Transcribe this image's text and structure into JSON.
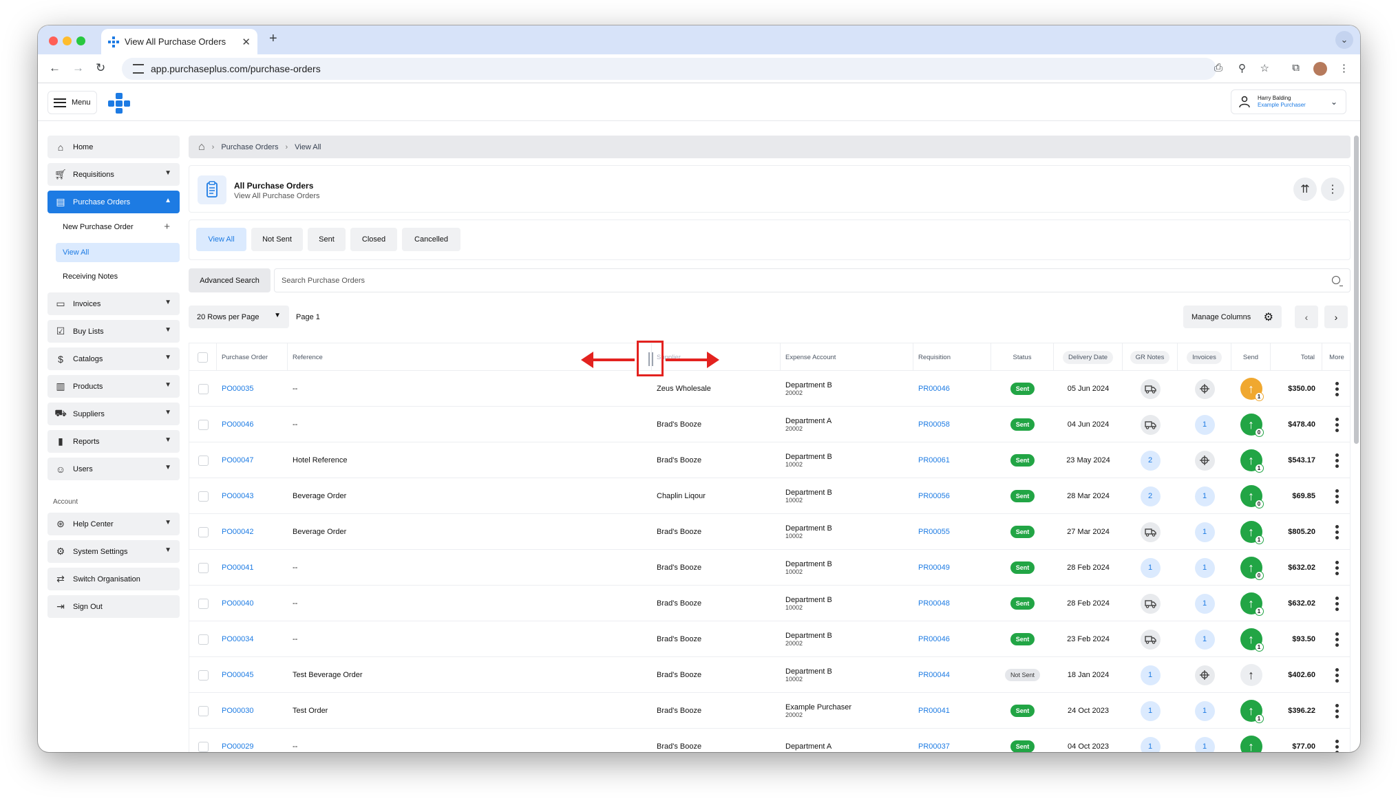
{
  "browser": {
    "tab_title": "View All Purchase Orders",
    "url": "app.purchaseplus.com/purchase-orders",
    "traffic_colors": [
      "#ff5f57",
      "#febc2e",
      "#28c840"
    ]
  },
  "header": {
    "menu_label": "Menu",
    "user_name": "Harry Balding",
    "user_role": "Example Purchaser"
  },
  "sidebar": {
    "home": "Home",
    "requisitions": "Requisitions",
    "purchase_orders": "Purchase Orders",
    "new_po": "New Purchase Order",
    "view_all": "View All",
    "receiving_notes": "Receiving Notes",
    "invoices": "Invoices",
    "buy_lists": "Buy Lists",
    "catalogs": "Catalogs",
    "products": "Products",
    "suppliers": "Suppliers",
    "reports": "Reports",
    "users": "Users",
    "account_label": "Account",
    "help_center": "Help Center",
    "system_settings": "System Settings",
    "switch_org": "Switch Organisation",
    "sign_out": "Sign Out"
  },
  "breadcrumb": {
    "level1": "Purchase Orders",
    "level2": "View All"
  },
  "page": {
    "title": "All Purchase Orders",
    "subtitle": "View All Purchase Orders"
  },
  "filters": [
    "View All",
    "Not Sent",
    "Sent",
    "Closed",
    "Cancelled"
  ],
  "search": {
    "advanced_label": "Advanced Search",
    "placeholder": "Search Purchase Orders"
  },
  "pagination": {
    "rows_label": "20 Rows per Page",
    "page_label": "Page 1",
    "manage_columns": "Manage Columns"
  },
  "table": {
    "headers": {
      "purchase_order": "Purchase Order",
      "reference": "Reference",
      "supplier": "Supplier",
      "expense_account": "Expense Account",
      "requisition": "Requisition",
      "status": "Status",
      "delivery_date": "Delivery Date",
      "gr_notes": "GR Notes",
      "invoices": "Invoices",
      "send": "Send",
      "total": "Total",
      "more": "More"
    },
    "rows": [
      {
        "po": "PO00035",
        "ref": "--",
        "supplier": "Zeus Wholesale",
        "dept": "Department B",
        "code": "20002",
        "req": "PR00046",
        "status": "Sent",
        "date": "05 Jun 2024",
        "gr": "truck",
        "inv": "target",
        "send": "orange",
        "send_count": "1",
        "total": "$350.00"
      },
      {
        "po": "PO00046",
        "ref": "--",
        "supplier": "Brad's Booze",
        "dept": "Department A",
        "code": "20002",
        "req": "PR00058",
        "status": "Sent",
        "date": "04 Jun 2024",
        "gr": "truck",
        "inv": "1",
        "send": "green",
        "send_count": "0",
        "total": "$478.40"
      },
      {
        "po": "PO00047",
        "ref": "Hotel Reference",
        "supplier": "Brad's Booze",
        "dept": "Department B",
        "code": "10002",
        "req": "PR00061",
        "status": "Sent",
        "date": "23 May 2024",
        "gr": "2",
        "inv": "target",
        "send": "green",
        "send_count": "1",
        "total": "$543.17"
      },
      {
        "po": "PO00043",
        "ref": "Beverage Order",
        "supplier": "Chaplin Liqour",
        "dept": "Department B",
        "code": "10002",
        "req": "PR00056",
        "status": "Sent",
        "date": "28 Mar 2024",
        "gr": "2",
        "inv": "1",
        "send": "green",
        "send_count": "0",
        "total": "$69.85"
      },
      {
        "po": "PO00042",
        "ref": "Beverage Order",
        "supplier": "Brad's Booze",
        "dept": "Department B",
        "code": "10002",
        "req": "PR00055",
        "status": "Sent",
        "date": "27 Mar 2024",
        "gr": "truck",
        "inv": "1",
        "send": "green",
        "send_count": "1",
        "total": "$805.20"
      },
      {
        "po": "PO00041",
        "ref": "--",
        "supplier": "Brad's Booze",
        "dept": "Department B",
        "code": "10002",
        "req": "PR00049",
        "status": "Sent",
        "date": "28 Feb 2024",
        "gr": "1",
        "inv": "1",
        "send": "green",
        "send_count": "0",
        "total": "$632.02"
      },
      {
        "po": "PO00040",
        "ref": "--",
        "supplier": "Brad's Booze",
        "dept": "Department B",
        "code": "10002",
        "req": "PR00048",
        "status": "Sent",
        "date": "28 Feb 2024",
        "gr": "truck",
        "inv": "1",
        "send": "green",
        "send_count": "1",
        "total": "$632.02"
      },
      {
        "po": "PO00034",
        "ref": "--",
        "supplier": "Brad's Booze",
        "dept": "Department B",
        "code": "20002",
        "req": "PR00046",
        "status": "Sent",
        "date": "23 Feb 2024",
        "gr": "truck",
        "inv": "1",
        "send": "green",
        "send_count": "1",
        "total": "$93.50"
      },
      {
        "po": "PO00045",
        "ref": "Test Beverage Order",
        "supplier": "Brad's Booze",
        "dept": "Department B",
        "code": "10002",
        "req": "PR00044",
        "status": "Not Sent",
        "date": "18 Jan 2024",
        "gr": "1",
        "inv": "target",
        "send": "none",
        "send_count": "",
        "total": "$402.60"
      },
      {
        "po": "PO00030",
        "ref": "Test Order",
        "supplier": "Brad's Booze",
        "dept": "Example Purchaser",
        "code": "20002",
        "req": "PR00041",
        "status": "Sent",
        "date": "24 Oct 2023",
        "gr": "1",
        "inv": "1",
        "send": "green",
        "send_count": "1",
        "total": "$396.22"
      },
      {
        "po": "PO00029",
        "ref": "--",
        "supplier": "Brad's Booze",
        "dept": "Department A",
        "code": "",
        "req": "PR00037",
        "status": "Sent",
        "date": "04 Oct 2023",
        "gr": "1",
        "inv": "1",
        "send": "green",
        "send_count": "",
        "total": "$77.00"
      }
    ]
  }
}
